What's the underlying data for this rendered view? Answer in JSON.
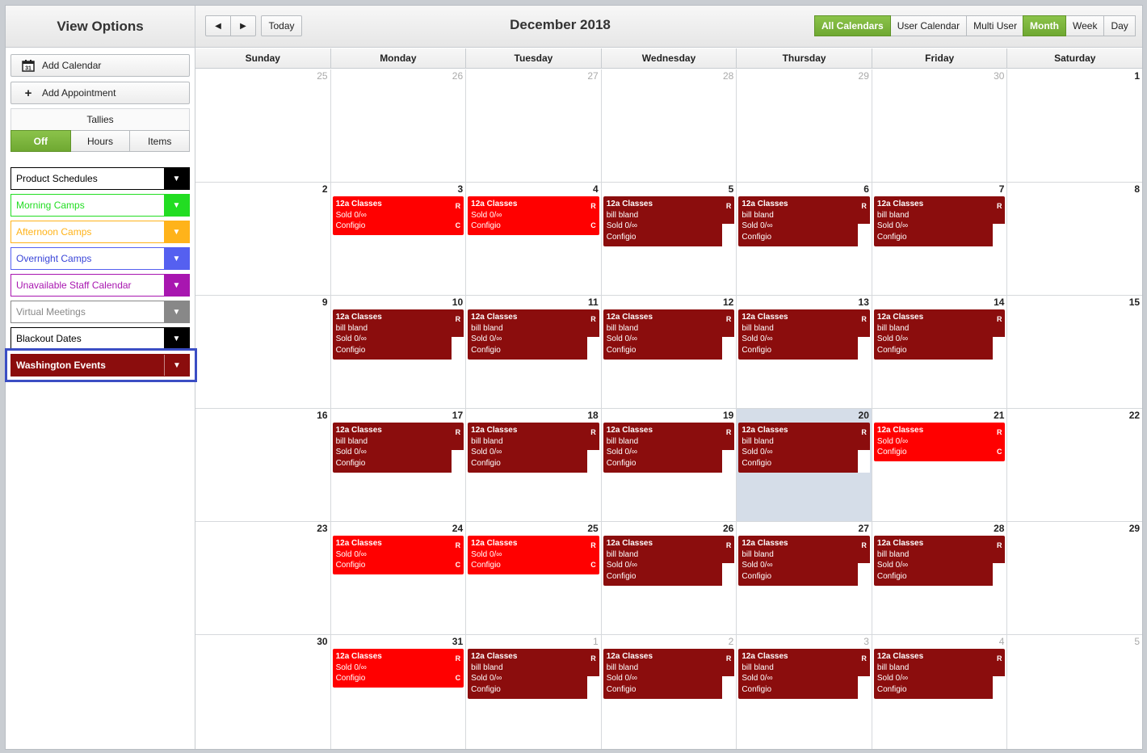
{
  "sidebar": {
    "title": "View Options",
    "add_calendar": "Add Calendar",
    "add_appointment": "Add Appointment",
    "tallies_label": "Tallies",
    "tallies": [
      "Off",
      "Hours",
      "Items"
    ],
    "calendars": [
      {
        "name": "Product Schedules",
        "color": "#000000",
        "text_color": "#000000"
      },
      {
        "name": "Morning Camps",
        "color": "#22dd22",
        "text_color": "#22dd22"
      },
      {
        "name": "Afternoon Camps",
        "color": "#ffb31a",
        "text_color": "#ffb31a"
      },
      {
        "name": "Overnight Camps",
        "color": "#5560f0",
        "text_color": "#3a45d8"
      },
      {
        "name": "Unavailable Staff Calendar",
        "color": "#a816b0",
        "text_color": "#a816b0"
      },
      {
        "name": "Virtual Meetings",
        "color": "#888888",
        "text_color": "#888888"
      },
      {
        "name": "Blackout Dates",
        "color": "#000000",
        "text_color": "#000000"
      },
      {
        "name": "Washington Events",
        "color": "#8b0d0d",
        "text_color": "#ffffff",
        "selected": true
      }
    ]
  },
  "toolbar": {
    "prev": "◀",
    "next": "▶",
    "today": "Today",
    "title": "December 2018",
    "calendar_modes": [
      "All Calendars",
      "User Calendar",
      "Multi User"
    ],
    "views": [
      "Month",
      "Week",
      "Day"
    ],
    "active_mode": "All Calendars",
    "active_view": "Month"
  },
  "day_headers": [
    "Sunday",
    "Monday",
    "Tuesday",
    "Wednesday",
    "Thursday",
    "Friday",
    "Saturday"
  ],
  "event_text": {
    "title": "12a Classes",
    "owner": "bill bland",
    "sold": "Sold 0/∞",
    "config": "Configio",
    "r_tag": "R",
    "c_tag": "C"
  },
  "weeks": [
    [
      {
        "d": "25",
        "o": true
      },
      {
        "d": "26",
        "o": true
      },
      {
        "d": "27",
        "o": true
      },
      {
        "d": "28",
        "o": true
      },
      {
        "d": "29",
        "o": true
      },
      {
        "d": "30",
        "o": true
      },
      {
        "d": "1"
      }
    ],
    [
      {
        "d": "2"
      },
      {
        "d": "3",
        "e": "red"
      },
      {
        "d": "4",
        "e": "red"
      },
      {
        "d": "5",
        "e": "dark"
      },
      {
        "d": "6",
        "e": "dark"
      },
      {
        "d": "7",
        "e": "dark"
      },
      {
        "d": "8"
      }
    ],
    [
      {
        "d": "9"
      },
      {
        "d": "10",
        "e": "dark"
      },
      {
        "d": "11",
        "e": "dark"
      },
      {
        "d": "12",
        "e": "dark"
      },
      {
        "d": "13",
        "e": "dark"
      },
      {
        "d": "14",
        "e": "dark"
      },
      {
        "d": "15"
      }
    ],
    [
      {
        "d": "16"
      },
      {
        "d": "17",
        "e": "dark"
      },
      {
        "d": "18",
        "e": "dark"
      },
      {
        "d": "19",
        "e": "dark"
      },
      {
        "d": "20",
        "e": "dark",
        "today": true
      },
      {
        "d": "21",
        "e": "red"
      },
      {
        "d": "22"
      }
    ],
    [
      {
        "d": "23"
      },
      {
        "d": "24",
        "e": "red"
      },
      {
        "d": "25",
        "e": "red"
      },
      {
        "d": "26",
        "e": "dark"
      },
      {
        "d": "27",
        "e": "dark"
      },
      {
        "d": "28",
        "e": "dark"
      },
      {
        "d": "29"
      }
    ],
    [
      {
        "d": "30"
      },
      {
        "d": "31",
        "e": "red"
      },
      {
        "d": "1",
        "o": true,
        "e": "dark"
      },
      {
        "d": "2",
        "o": true,
        "e": "dark"
      },
      {
        "d": "3",
        "o": true,
        "e": "dark"
      },
      {
        "d": "4",
        "o": true,
        "e": "dark"
      },
      {
        "d": "5",
        "o": true
      }
    ]
  ]
}
